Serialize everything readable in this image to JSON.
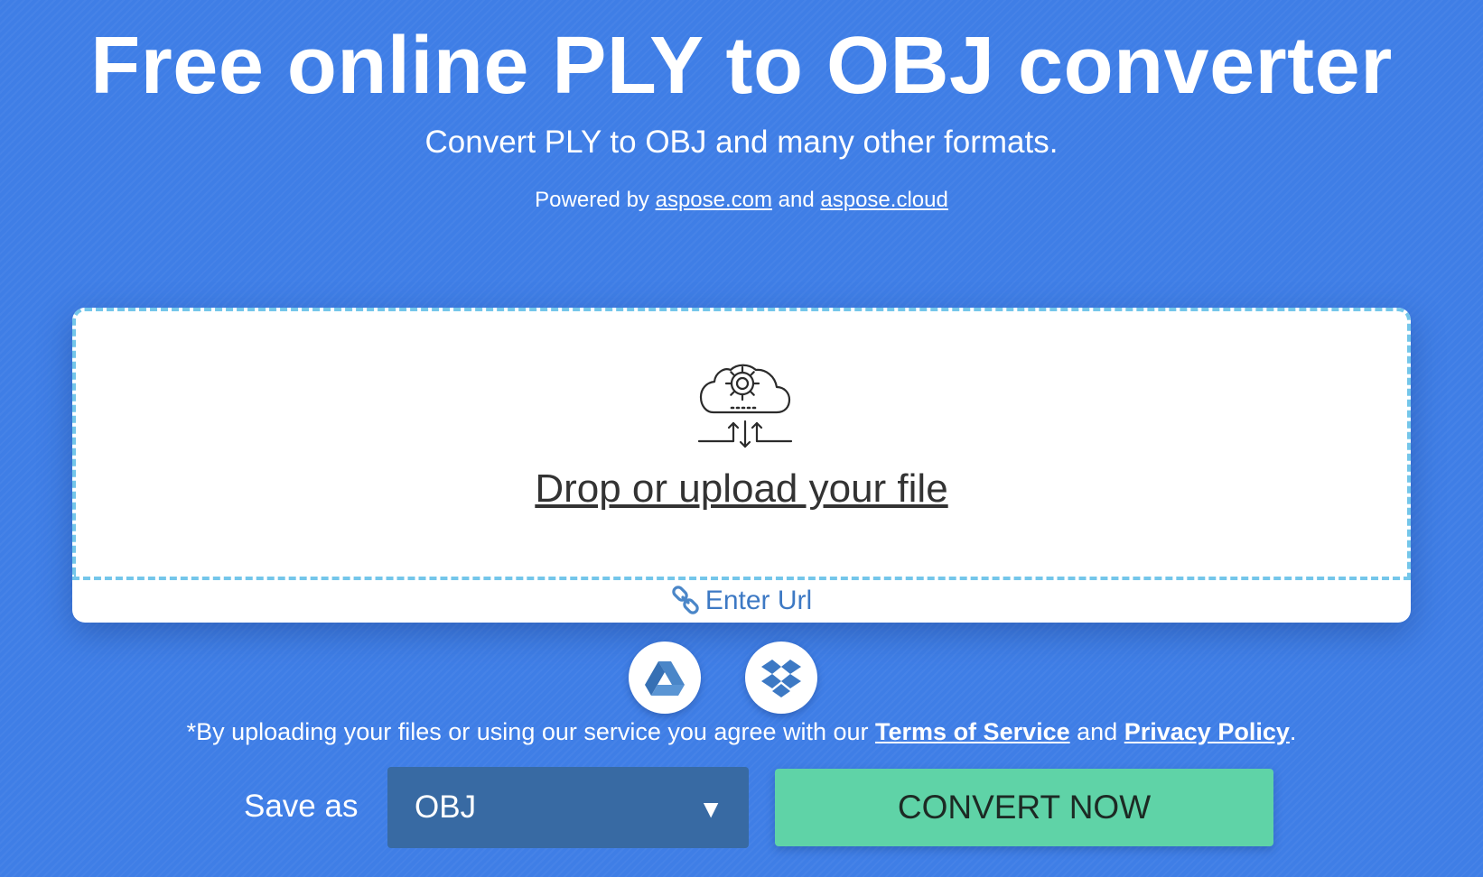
{
  "header": {
    "title": "Free online PLY to OBJ converter",
    "subtitle": "Convert PLY to OBJ and many other formats.",
    "powered_prefix": "Powered by",
    "powered_link1": "aspose.com",
    "powered_and": "and",
    "powered_link2": "aspose.cloud"
  },
  "upload": {
    "icon": "cloud-gear-upload-icon",
    "drop_label": "Drop or upload your file",
    "enter_url_label": "Enter Url"
  },
  "cloud_sources": [
    {
      "name": "google-drive",
      "icon": "google-drive-icon"
    },
    {
      "name": "dropbox",
      "icon": "dropbox-icon"
    }
  ],
  "terms": {
    "prefix": "*By uploading your files or using our service you agree with our",
    "tos_label": "Terms of Service",
    "and": "and",
    "privacy_label": "Privacy Policy",
    "suffix": "."
  },
  "convert": {
    "save_as_label": "Save as",
    "format_value": "OBJ",
    "dropdown_arrow": "▼",
    "button_label": "CONVERT NOW"
  },
  "colors": {
    "background": "#3f7ee6",
    "dashed_border": "#74c6ea",
    "select_bg": "#386aa3",
    "convert_bg": "#5fd3a7",
    "link_blue": "#3d79c4"
  }
}
